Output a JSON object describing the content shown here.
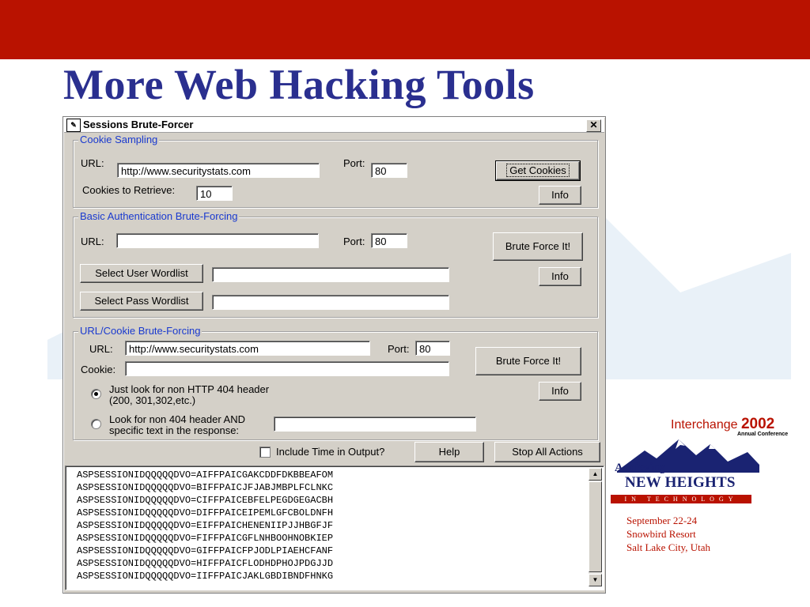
{
  "slide": {
    "title": "More Web Hacking Tools",
    "accent_color": "#b91200",
    "title_color": "#2a2f8f"
  },
  "window": {
    "title": "Sessions Brute-Forcer",
    "close_label": "✕"
  },
  "cookie_sampling": {
    "legend": "Cookie Sampling",
    "url_label": "URL:",
    "url_value": "http://www.securitystats.com",
    "port_label": "Port:",
    "port_value": "80",
    "cookies_label": "Cookies to Retrieve:",
    "cookies_value": "10",
    "get_cookies_label": "Get Cookies",
    "info_label": "Info"
  },
  "basic_auth": {
    "legend": "Basic Authentication Brute-Forcing",
    "url_label": "URL:",
    "url_value": "",
    "port_label": "Port:",
    "port_value": "80",
    "brute_label": "Brute Force It!",
    "user_wordlist_label": "Select User Wordlist",
    "user_wordlist_value": "",
    "pass_wordlist_label": "Select Pass Wordlist",
    "pass_wordlist_value": "",
    "info_label": "Info"
  },
  "url_cookie": {
    "legend": "URL/Cookie Brute-Forcing",
    "url_label": "URL:",
    "url_value": "http://www.securitystats.com",
    "port_label": "Port:",
    "port_value": "80",
    "cookie_label": "Cookie:",
    "cookie_value": "",
    "brute_label": "Brute Force It!",
    "radio1_line1": "Just look for non HTTP 404 header",
    "radio1_line2": "(200, 301,302,etc.)",
    "radio2_line1": "Look for non 404 header AND",
    "radio2_line2": "specific text in the response:",
    "radio2_value": "",
    "info_label": "Info",
    "selected_option": 1
  },
  "bottom_bar": {
    "include_time_label": "Include Time in Output?",
    "include_time_checked": false,
    "help_label": "Help",
    "stop_label": "Stop All Actions"
  },
  "output_lines": [
    "ASPSESSIONIDQQQQQDVO=AIFFPAICGAKCDDFDKBBEAFOM",
    "ASPSESSIONIDQQQQQDVO=BIFFPAICJFJABJMBPLFCLNKC",
    "ASPSESSIONIDQQQQQDVO=CIFFPAICEBFELPEGDGEGACBH",
    "ASPSESSIONIDQQQQQDVO=DIFFPAICEIPEMLGFCBOLDNFH",
    "ASPSESSIONIDQQQQQDVO=EIFFPAICHENENIIPJJHBGFJF",
    "ASPSESSIONIDQQQQQDVO=FIFFPAICGFLNHBOOHNOBKIEP",
    "ASPSESSIONIDQQQQQDVO=GIFFPAICFPJODLPIAEHCFANF",
    "ASPSESSIONIDQQQQQDVO=HIFFPAICFLODHDPHOJPDGJJD",
    "ASPSESSIONIDQQQQQDVO=IIFFPAICJAKLGBDIBNDFHNKG"
  ],
  "logo": {
    "interchange": "Interchange",
    "year": "2002",
    "annual": "Annual Conference",
    "achieving": "Achieving",
    "new_heights": "NEW HEIGHTS",
    "in_technology": "IN TECHNOLOGY",
    "dates": "September 22-24",
    "venue": "Snowbird Resort",
    "city": "Salt Lake City, Utah"
  }
}
